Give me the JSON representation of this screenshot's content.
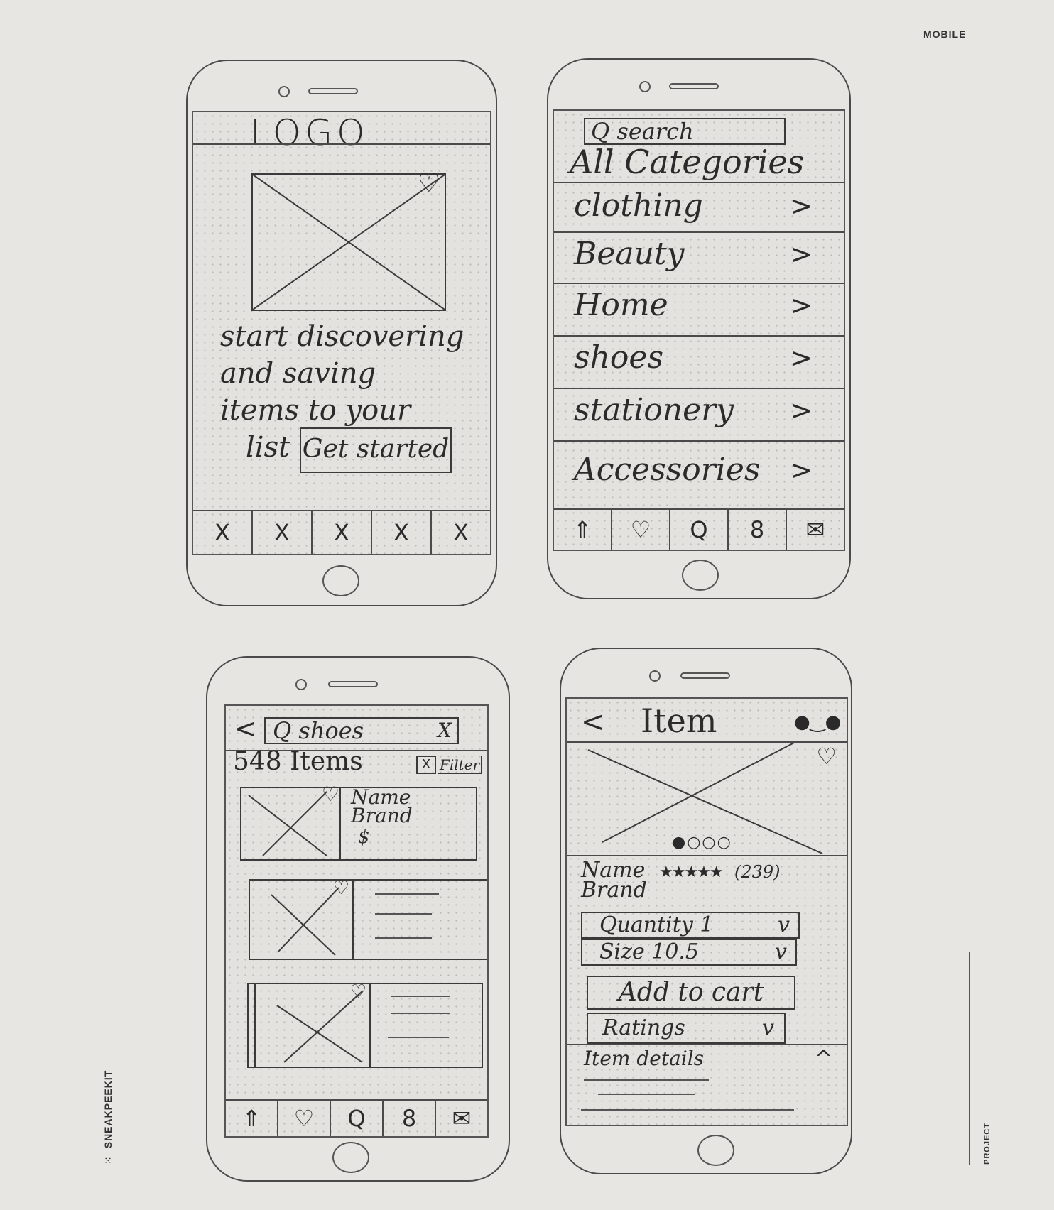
{
  "meta": {
    "top_right_label": "MOBILE",
    "left_brand": "SNEAKPEEKIT",
    "bottom_right_label": "PROJECT"
  },
  "screen1": {
    "logo": "LOGO",
    "tagline_lines": [
      "start discovering",
      "and saving",
      "items to your",
      "list"
    ],
    "cta_label": "Get started",
    "tab_icons": [
      "X",
      "X",
      "X",
      "X",
      "X"
    ]
  },
  "screen2": {
    "search_label": "Q search",
    "header": "All Categories",
    "categories": [
      {
        "label": "clothing",
        "chevron": ">"
      },
      {
        "label": "Beauty",
        "chevron": ">"
      },
      {
        "label": "Home",
        "chevron": ">"
      },
      {
        "label": "shoes",
        "chevron": ">"
      },
      {
        "label": "stationery",
        "chevron": ">"
      },
      {
        "label": "Accessories",
        "chevron": ">"
      }
    ],
    "tab_icons": [
      "⇑",
      "♡",
      "Q",
      "8",
      "✉"
    ]
  },
  "screen3": {
    "back": "<",
    "search_text": "Q shoes",
    "clear": "X",
    "count": "548 Items",
    "filter_icon": "X",
    "filter_label": "Filter",
    "first_result": {
      "name": "Name",
      "brand": "Brand",
      "price": "$"
    },
    "tab_icons": [
      "⇑",
      "♡",
      "Q",
      "8",
      "✉"
    ]
  },
  "screen4": {
    "back": "<",
    "title": "Item",
    "pager_dots": "●○○○",
    "name": "Name",
    "brand": "Brand",
    "stars": "★★★★★",
    "review_count": "(239)",
    "quantity_label": "Quantity 1",
    "size_label": "Size 10.5",
    "dropdown_chevron": "v",
    "add_to_cart": "Add to cart",
    "ratings_label": "Ratings",
    "item_details_label": "Item details",
    "expand_chevron": "^"
  }
}
